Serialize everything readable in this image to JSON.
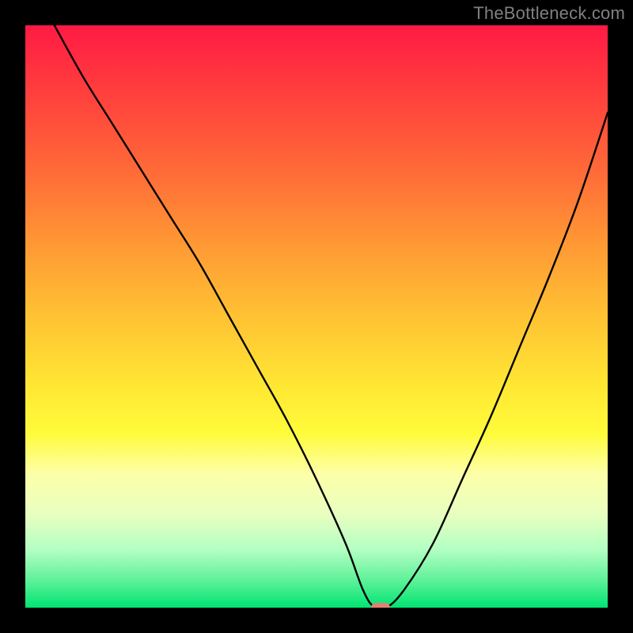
{
  "watermark": "TheBottleneck.com",
  "chart_data": {
    "type": "line",
    "title": "",
    "xlabel": "",
    "ylabel": "",
    "xlim": [
      0,
      100
    ],
    "ylim": [
      0,
      100
    ],
    "gradient_bands": [
      {
        "name": "red",
        "approx_y": 100
      },
      {
        "name": "orange",
        "approx_y": 65
      },
      {
        "name": "yellow",
        "approx_y": 30
      },
      {
        "name": "pale",
        "approx_y": 15
      },
      {
        "name": "green",
        "approx_y": 0
      }
    ],
    "series": [
      {
        "name": "bottleneck-curve",
        "x": [
          5,
          10,
          15,
          20,
          25,
          30,
          35,
          40,
          45,
          50,
          55,
          58,
          60,
          62,
          65,
          70,
          75,
          80,
          85,
          90,
          95,
          100
        ],
        "y": [
          100,
          91,
          83,
          75,
          67,
          59,
          50,
          41,
          32,
          22,
          11,
          3,
          0,
          0,
          3,
          11,
          22,
          33,
          45,
          57,
          70,
          85
        ]
      }
    ],
    "marker": {
      "x": 61,
      "y": 0,
      "color": "#e37f72",
      "shape": "capsule"
    }
  }
}
